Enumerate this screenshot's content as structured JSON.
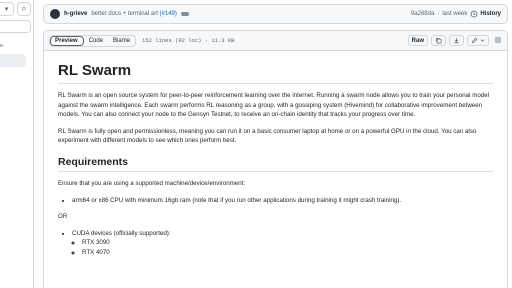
{
  "sidebar": {
    "dropdown_glyph": "▾",
    "search_icon": "search-icon",
    "search_glyph": "⌕",
    "text_fragment": "e."
  },
  "commit": {
    "author": "h-grieve",
    "message": "better docs + terminal art",
    "pr": "(#149)",
    "hash": "9a268da",
    "separator": "·",
    "time": "last week",
    "history_icon": "history-icon",
    "history_label": "History"
  },
  "file_header": {
    "tabs": [
      "Preview",
      "Code",
      "Blame"
    ],
    "active_tab": "Preview",
    "meta": "152 lines (92 loc) · 11.3 KB",
    "raw_label": "Raw",
    "copy_icon": "copy-icon",
    "download_icon": "download-icon",
    "edit_icon": "pencil-icon",
    "more_icon": "chevron-down-icon",
    "toc_icon": "list-icon"
  },
  "readme": {
    "title": "RL Swarm",
    "para1": "RL Swarm is an open source system for peer-to-peer reinforcement learning over the internet. Running a swarm node allows you to train your personal model against the swarm intelligence. Each swarm performs RL reasoning as a group, with a gossiping system (Hivemind) for collaborative improvement between models. You can also connect your node to the Gensyn Testnet, to receive an on-chain identity that tracks your progress over time.",
    "para2": "RL Swarm is fully open and permissionless, meaning you can run it on a basic consumer laptop at home or on a powerful GPU in the cloud. You can also experiment with different models to see which ones perform best.",
    "requirements_heading": "Requirements",
    "requirements_intro": "Ensure that you are using a supported machine/device/environment:",
    "req_item1": "arm64 or x86 CPU with minimum 16gb ram (note that if you run other applications during training it might crash training).",
    "or_text": "OR",
    "req_item2": "CUDA devices (officially supported):",
    "cuda_devices": [
      "RTX 3090",
      "RTX 4070"
    ]
  }
}
